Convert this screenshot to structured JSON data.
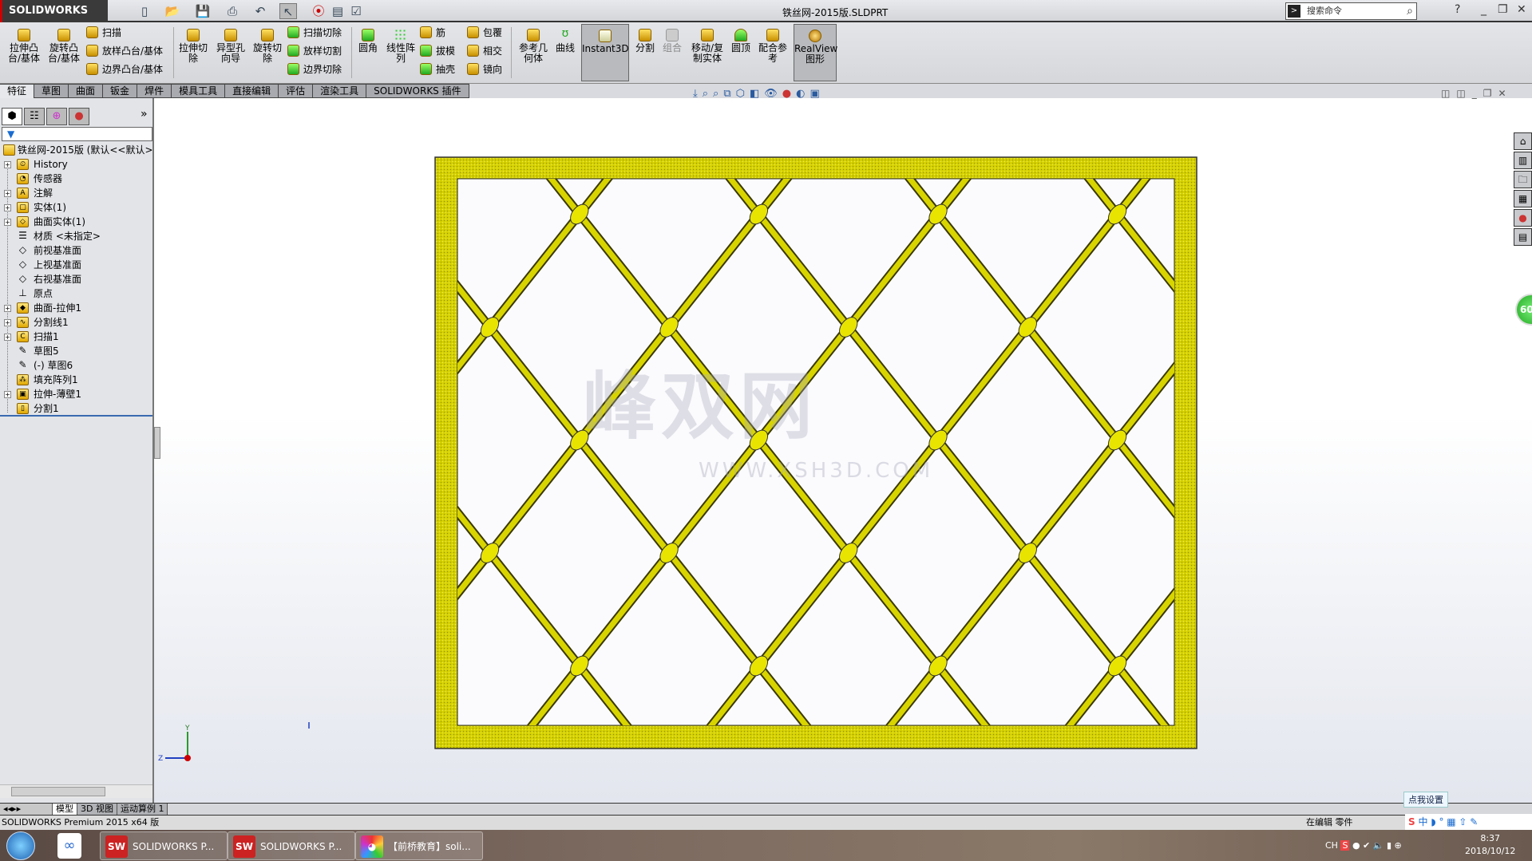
{
  "app": {
    "logo": "SOLIDWORKS",
    "title": "铁丝网-2015版.SLDPRT",
    "search_placeholder": "搜索命令"
  },
  "ribbon": {
    "extrude_boss": "拉伸凸台/基体",
    "revolve_boss": "旋转凸台/基体",
    "sweep": "扫描",
    "loft": "放样凸台/基体",
    "boundary_boss": "边界凸台/基体",
    "extrude_cut": "拉伸切除",
    "hole_wizard": "异型孔向导",
    "revolve_cut": "旋转切除",
    "swept_cut": "扫描切除",
    "lofted_cut": "放样切割",
    "boundary_cut": "边界切除",
    "fillet": "圆角",
    "linear_pattern": "线性阵列",
    "rib": "筋",
    "draft": "拔模",
    "shell": "抽壳",
    "wrap": "包覆",
    "intersect": "相交",
    "mirror": "镜向",
    "ref_geometry": "参考几何体",
    "curves": "曲线",
    "instant3d": "Instant3D",
    "split": "分割",
    "combine": "组合",
    "move_copy": "移动/复制实体",
    "dome": "圆顶",
    "mate_ref": "配合参考",
    "realview": "RealView图形"
  },
  "tabs": [
    "特征",
    "草图",
    "曲面",
    "钣金",
    "焊件",
    "模具工具",
    "直接编辑",
    "评估",
    "渲染工具",
    "SOLIDWORKS 插件"
  ],
  "tree": {
    "root": "铁丝网-2015版  (默认<<默认>_",
    "items": [
      {
        "label": "History",
        "expand": true
      },
      {
        "label": "传感器",
        "expand": false
      },
      {
        "label": "注解",
        "expand": true
      },
      {
        "label": "实体(1)",
        "expand": true
      },
      {
        "label": "曲面实体(1)",
        "expand": true
      },
      {
        "label": "材质 <未指定>",
        "expand": false
      },
      {
        "label": "前视基准面",
        "expand": false
      },
      {
        "label": "上视基准面",
        "expand": false
      },
      {
        "label": "右视基准面",
        "expand": false
      },
      {
        "label": "原点",
        "expand": false
      },
      {
        "label": "曲面-拉伸1",
        "expand": true
      },
      {
        "label": "分割线1",
        "expand": true
      },
      {
        "label": "扫描1",
        "expand": true
      },
      {
        "label": "草图5",
        "expand": false
      },
      {
        "label": "(-) 草图6",
        "expand": false
      },
      {
        "label": "填充阵列1",
        "expand": false
      },
      {
        "label": "拉伸-薄壁1",
        "expand": true
      },
      {
        "label": "分割1",
        "expand": false
      }
    ]
  },
  "bottom_tabs": [
    "模型",
    "3D 视图",
    "运动算例 1"
  ],
  "status": {
    "version": "SOLIDWORKS Premium 2015 x64 版",
    "mode": "在编辑 零件",
    "tip": "点我设置",
    "ime": "中"
  },
  "watermark": {
    "name": "峰双网",
    "url": "WWW.XSH3D.COM"
  },
  "fps": "60",
  "taskbar": {
    "tasks": [
      "SOLIDWORKS P...",
      "SOLIDWORKS P...",
      "【前桥教育】soli..."
    ],
    "lang": "CH",
    "time": "8:37",
    "date": "2018/10/12"
  },
  "colors": {
    "metal": "#d8d400",
    "frame_dark": "#8a8800",
    "accent": "#3a6ab0"
  }
}
